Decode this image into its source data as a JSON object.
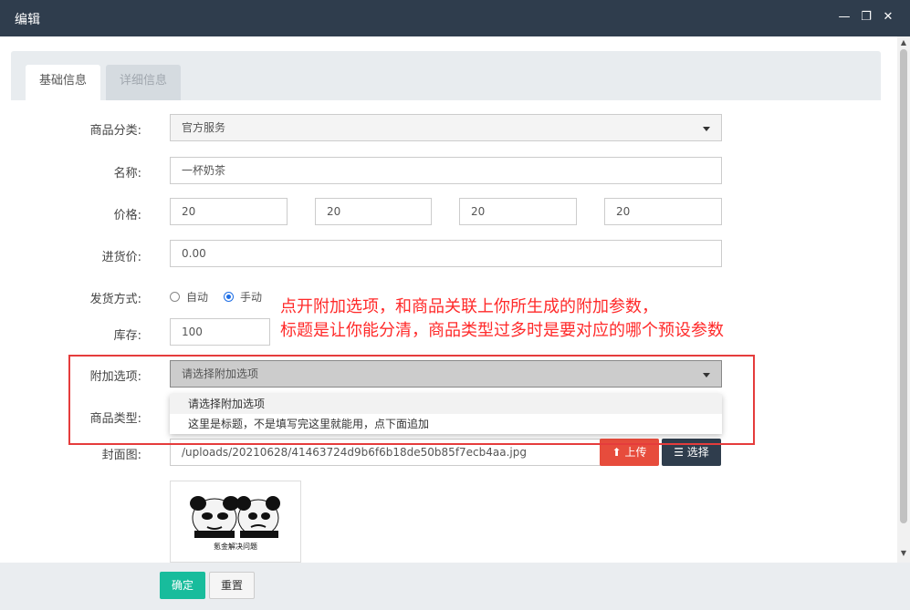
{
  "window": {
    "title": "编辑",
    "minimize": "—",
    "maximize": "❐",
    "close": "✕"
  },
  "tabs": [
    {
      "label": "基础信息",
      "active": true
    },
    {
      "label": "详细信息",
      "active": false
    }
  ],
  "form": {
    "category": {
      "label": "商品分类:",
      "value": "官方服务"
    },
    "name": {
      "label": "名称:",
      "value": "一杯奶茶"
    },
    "price": {
      "label": "价格:",
      "values": [
        "20",
        "20",
        "20",
        "20"
      ]
    },
    "cost": {
      "label": "进货价:",
      "value": "0.00"
    },
    "delivery": {
      "label": "发货方式:",
      "options": [
        "自动",
        "手动"
      ],
      "selected": "手动"
    },
    "stock": {
      "label": "库存:",
      "value": "100"
    },
    "addon": {
      "label": "附加选项:",
      "value": "请选择附加选项"
    },
    "type": {
      "label": "商品类型:"
    },
    "cover": {
      "label": "封面图:",
      "value": "/uploads/20210628/41463724d9b6f6b18de50b85f7ecb4aa.jpg",
      "upload_label": "上传",
      "choose_label": "选择",
      "thumb_caption": "氪金解决问题"
    }
  },
  "dropdown": {
    "options": [
      "请选择附加选项",
      "这里是标题，不是填写完这里就能用，点下面追加"
    ]
  },
  "annotation": {
    "line1": "点开附加选项，和商品关联上你所生成的附加参数，",
    "line2": "标题是让你能分清，商品类型过多时是要对应的哪个预设参数"
  },
  "footer": {
    "ok_label": "确定",
    "reset_label": "重置"
  },
  "colors": {
    "titlebar": "#2f3d4d",
    "ok": "#18bc9c",
    "upload": "#e74c3c",
    "annotation": "#ff2a2a"
  }
}
